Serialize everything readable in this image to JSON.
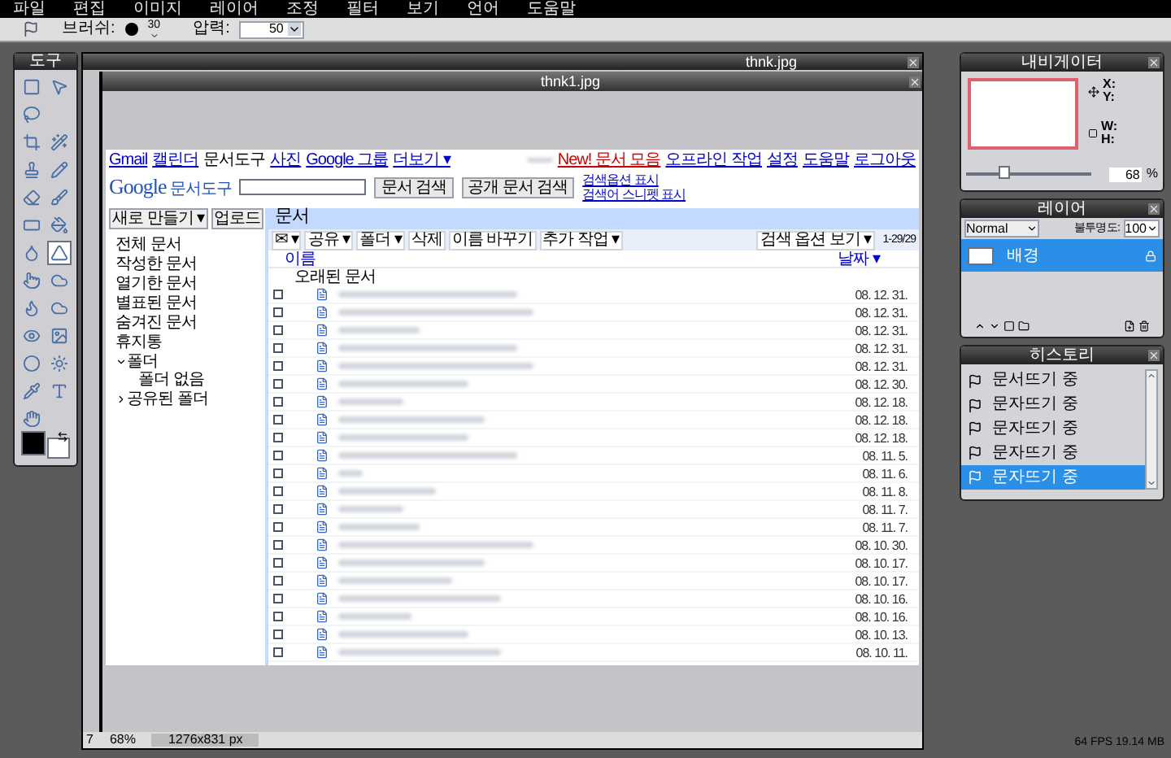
{
  "menu": [
    "파일",
    "편집",
    "이미지",
    "레이어",
    "조정",
    "필터",
    "보기",
    "언어",
    "도움말"
  ],
  "toolbar": {
    "brush_label": "브러쉬:",
    "brush_size": "30",
    "pressure_label": "압력:",
    "pressure": "50"
  },
  "tools_panel": {
    "title": "도구",
    "tools": [
      {
        "selected": false
      },
      {
        "selected": false
      },
      {
        "selected": false
      },
      {
        "selected": false
      },
      {
        "selected": false
      },
      {
        "selected": false
      },
      {
        "selected": false
      },
      {
        "selected": false
      },
      {
        "selected": false
      },
      {
        "selected": false
      },
      {
        "selected": false
      },
      {
        "selected": false
      },
      {
        "selected": false
      },
      {
        "selected": true
      },
      {
        "selected": false
      },
      {
        "selected": false
      },
      {
        "selected": false
      },
      {
        "selected": false
      },
      {
        "selected": false
      },
      {
        "selected": false
      },
      {
        "selected": false
      },
      {
        "selected": false
      },
      {
        "selected": false
      },
      {
        "selected": false
      },
      {
        "selected": false
      }
    ]
  },
  "outer_window": {
    "title": "thnk.jpg",
    "status": {
      "frame": "7",
      "zoom": "68%",
      "size": "1276x831 px"
    }
  },
  "inner_window": {
    "title": "thnk1.jpg"
  },
  "docs_page": {
    "top_links": [
      "Gmail",
      "캘린더",
      "문서도구",
      "사진",
      "Google 그룹",
      "더보기 ▾"
    ],
    "account_links": [
      {
        "label": "New! 문서 모음",
        "kind": "highlight"
      },
      {
        "label": "오프라인 작업",
        "kind": "link"
      },
      {
        "label": "설정",
        "kind": "link"
      },
      {
        "label": "도움말",
        "kind": "link"
      },
      {
        "label": "로그아웃",
        "kind": "link"
      }
    ],
    "logo": {
      "brand": "Google",
      "product": "문서도구"
    },
    "search_buttons": [
      "문서 검색",
      "공개 문서 검색"
    ],
    "search_links": [
      "검색옵션 표시",
      "검색어 스니펫 표시"
    ],
    "new_button": "새로 만들기 ▾",
    "upload_button": "업로드",
    "sidebar": [
      {
        "label": "전체 문서"
      },
      {
        "label": "작성한 문서"
      },
      {
        "label": "열기한 문서"
      },
      {
        "label": "별표된 문서"
      },
      {
        "label": "숨겨진 문서"
      },
      {
        "label": "휴지통"
      },
      {
        "label": "폴더",
        "expanded": true,
        "children": [
          {
            "label": "폴더 없음"
          }
        ]
      },
      {
        "label": "공유된 폴더",
        "expanded": false
      }
    ],
    "heading": "문서",
    "actions": [
      "✉ ▾",
      "공유 ▾",
      "폴더 ▾",
      "삭제",
      "이름 바꾸기",
      "추가 작업 ▾"
    ],
    "view_button": "검색 옵션 보기 ▾",
    "count": "1-29/29",
    "columns": {
      "name": "이름",
      "date": "날짜 ▾"
    },
    "group": "오래된 문서",
    "rows": [
      {
        "checked": false,
        "date": "08. 12. 31."
      },
      {
        "checked": false,
        "date": "08. 12. 31."
      },
      {
        "checked": false,
        "date": "08. 12. 31."
      },
      {
        "checked": false,
        "date": "08. 12. 31."
      },
      {
        "checked": false,
        "date": "08. 12. 31."
      },
      {
        "checked": false,
        "date": "08. 12. 30."
      },
      {
        "checked": false,
        "date": "08. 12. 18."
      },
      {
        "checked": false,
        "date": "08. 12. 18."
      },
      {
        "checked": false,
        "date": "08. 12. 18."
      },
      {
        "checked": false,
        "date": "08. 11. 5."
      },
      {
        "checked": false,
        "date": "08. 11. 6."
      },
      {
        "checked": false,
        "date": "08. 11. 8."
      },
      {
        "checked": false,
        "date": "08. 11. 7."
      },
      {
        "checked": false,
        "date": "08. 11. 7."
      },
      {
        "checked": false,
        "date": "08. 10. 30."
      },
      {
        "checked": false,
        "date": "08. 10. 17."
      },
      {
        "checked": false,
        "date": "08. 10. 17."
      },
      {
        "checked": false,
        "date": "08. 10. 16."
      },
      {
        "checked": false,
        "date": "08. 10. 16."
      },
      {
        "checked": false,
        "date": "08. 10. 13."
      },
      {
        "checked": false,
        "date": "08. 10. 11."
      }
    ]
  },
  "navigator": {
    "title": "내비게이터",
    "x_label": "X:",
    "y_label": "Y:",
    "w_label": "W:",
    "h_label": "H:",
    "level": 0.3,
    "zoom": "68",
    "unit": "%"
  },
  "layers": {
    "title": "레이어",
    "blend": "Normal",
    "opacity_label": "불투명도:",
    "opacity": "100",
    "items": [
      {
        "name": "배경",
        "selected": true,
        "locked": true
      }
    ]
  },
  "history": {
    "title": "히스토리",
    "items": [
      {
        "label": "문서뜨기 중",
        "selected": false
      },
      {
        "label": "문자뜨기 중",
        "selected": false
      },
      {
        "label": "문자뜨기 중",
        "selected": false
      },
      {
        "label": "문자뜨기 중",
        "selected": false
      },
      {
        "label": "문자뜨기 중",
        "selected": true
      }
    ]
  },
  "stats": "64 FPS 19.14 MB"
}
